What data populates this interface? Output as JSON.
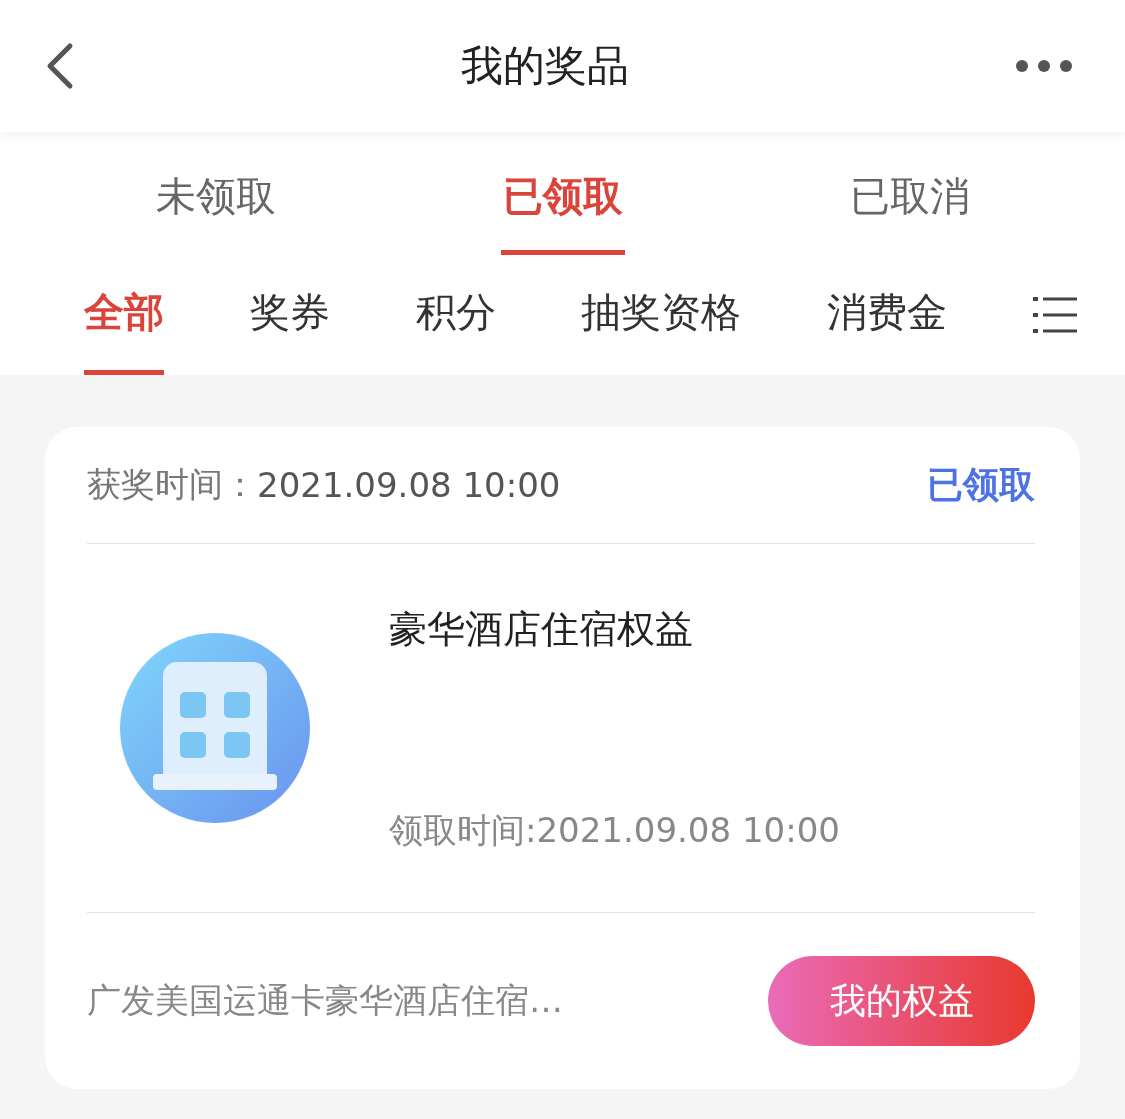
{
  "header": {
    "title": "我的奖品"
  },
  "status_tabs": [
    {
      "label": "未领取",
      "selected": false
    },
    {
      "label": "已领取",
      "selected": true
    },
    {
      "label": "已取消",
      "selected": false
    }
  ],
  "category_tabs": [
    {
      "label": "全部",
      "selected": true
    },
    {
      "label": "奖券",
      "selected": false
    },
    {
      "label": "积分",
      "selected": false
    },
    {
      "label": "抽奖资格",
      "selected": false
    },
    {
      "label": "消费金",
      "selected": false
    }
  ],
  "prize_card": {
    "award_time_label": "获奖时间：",
    "award_time": "2021.09.08 10:00",
    "status": "已领取",
    "prize_name": "豪华酒店住宿权益",
    "claim_time": "领取时间:2021.09.08 10:00",
    "description": "广发美国运通卡豪华酒店住宿…",
    "action": "我的权益"
  }
}
